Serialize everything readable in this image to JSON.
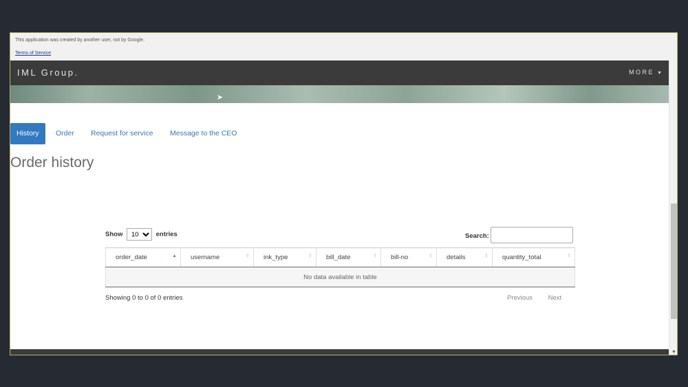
{
  "notice": {
    "text": "This application was created by another user, not by Google.",
    "terms_link": "Terms of Service"
  },
  "topbar": {
    "brand": "IML Group.",
    "more_label": "MORE"
  },
  "tabs": [
    {
      "label": "History",
      "active": true
    },
    {
      "label": "Order",
      "active": false
    },
    {
      "label": "Request for service",
      "active": false
    },
    {
      "label": "Message to the CEO",
      "active": false
    }
  ],
  "page_title": "Order history",
  "table_controls": {
    "show_label": "Show",
    "entries_label": "entries",
    "page_length": "10",
    "search_label": "Search:"
  },
  "table": {
    "columns": [
      "order_date",
      "username",
      "ink_type",
      "bill_date",
      "bill-no",
      "details",
      "quantity_total"
    ],
    "empty_message": "No data available in table"
  },
  "footer": {
    "info": "Showing 0 to 0 of 0 entries",
    "previous": "Previous",
    "next": "Next"
  },
  "colors": {
    "accent": "#3279c0",
    "topbar": "#3b3b3b",
    "outer_background": "#262a33"
  }
}
